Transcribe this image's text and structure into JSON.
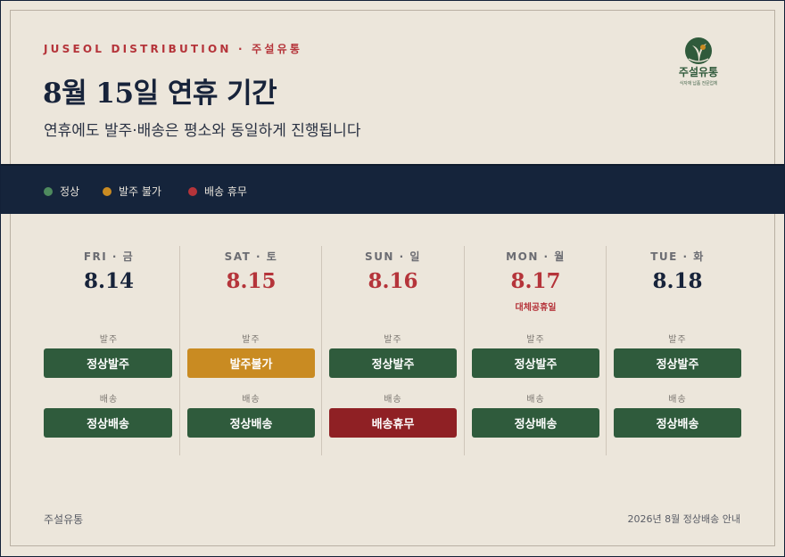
{
  "brand": "JUSEOL DISTRIBUTION · 주설유통",
  "title": "8월 15일 연휴 기간",
  "subtitle": "연휴에도 발주·배송은 평소와 동일하게 진행됩니다",
  "logo": {
    "name": "주설유통",
    "tagline": "식자재 납품 전문업체"
  },
  "colors": {
    "normal": "#2f5b3c",
    "order_unavailable": "#c98b22",
    "delivery_off": "#8f2024",
    "navy": "#15243b",
    "holiday_red": "#b5343a"
  },
  "legend": [
    {
      "label": "정상",
      "color": "#4e8a5e"
    },
    {
      "label": "발주 불가",
      "color": "#c98b22"
    },
    {
      "label": "배송 휴무",
      "color": "#b5343a"
    }
  ],
  "section_labels": {
    "order": "발주",
    "delivery": "배송"
  },
  "days": [
    {
      "day": "FRI · 금",
      "date": "8.14",
      "holiday": false,
      "note": "",
      "order": "정상발주",
      "order_status": "normal",
      "delivery": "정상배송",
      "delivery_status": "normal"
    },
    {
      "day": "SAT · 토",
      "date": "8.15",
      "holiday": true,
      "note": "",
      "order": "발주불가",
      "order_status": "order_unavailable",
      "delivery": "정상배송",
      "delivery_status": "normal"
    },
    {
      "day": "SUN · 일",
      "date": "8.16",
      "holiday": true,
      "note": "",
      "order": "정상발주",
      "order_status": "normal",
      "delivery": "배송휴무",
      "delivery_status": "delivery_off"
    },
    {
      "day": "MON · 월",
      "date": "8.17",
      "holiday": true,
      "note": "대체공휴일",
      "order": "정상발주",
      "order_status": "normal",
      "delivery": "정상배송",
      "delivery_status": "normal"
    },
    {
      "day": "TUE · 화",
      "date": "8.18",
      "holiday": false,
      "note": "",
      "order": "정상발주",
      "order_status": "normal",
      "delivery": "정상배송",
      "delivery_status": "normal"
    }
  ],
  "footer": {
    "left": "주설유통",
    "right": "2026년 8월 정상배송 안내"
  }
}
